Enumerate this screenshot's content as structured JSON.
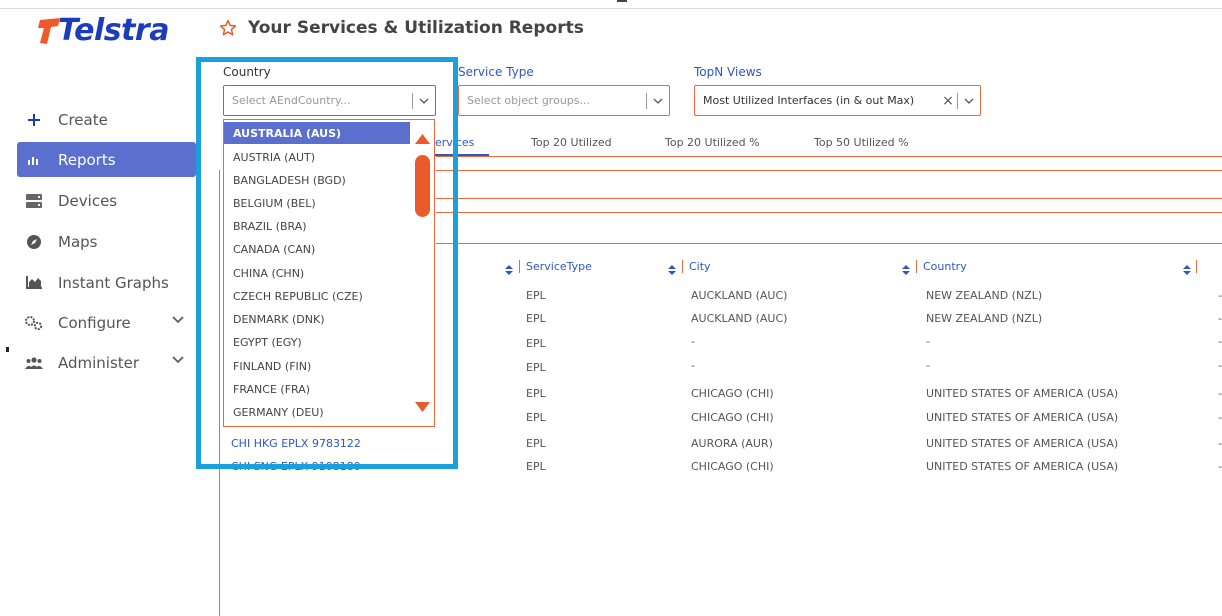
{
  "app": {
    "logo_text": "Telstra",
    "page_title": "Your Services & Utilization Reports",
    "accent_color": "#ea6a3e",
    "brand_color": "#1a3cbd",
    "active_color": "#5b6fcf"
  },
  "sidebar": {
    "items": [
      {
        "label": "Create",
        "icon": "plus-icon",
        "active": false
      },
      {
        "label": "Reports",
        "icon": "bar-chart-icon",
        "active": true
      },
      {
        "label": "Devices",
        "icon": "server-icon",
        "active": false
      },
      {
        "label": "Maps",
        "icon": "compass-icon",
        "active": false
      },
      {
        "label": "Instant Graphs",
        "icon": "area-chart-icon",
        "active": false
      },
      {
        "label": "Configure",
        "icon": "gears-icon",
        "active": false
      },
      {
        "label": "Administer",
        "icon": "users-icon",
        "active": false
      }
    ]
  },
  "filters": {
    "country": {
      "label": "Country",
      "placeholder": "Select AEndCountry..."
    },
    "service_type": {
      "label": "Service Type",
      "placeholder": "Select object groups..."
    },
    "topn": {
      "label": "TopN Views",
      "value": "Most Utilized Interfaces (in & out Max)"
    }
  },
  "country_dropdown": {
    "options": [
      "AUSTRALIA (AUS)",
      "AUSTRIA (AUT)",
      "BANGLADESH (BGD)",
      "BELGIUM (BEL)",
      "BRAZIL (BRA)",
      "CANADA (CAN)",
      "CHINA (CHN)",
      "CZECH REPUBLIC (CZE)",
      "DENMARK (DNK)",
      "EGYPT (EGY)",
      "FINLAND (FIN)",
      "FRANCE (FRA)",
      "GERMANY (DEU)"
    ],
    "selected": "AUSTRALIA (AUS)"
  },
  "tabs": {
    "items": [
      "ervices",
      "Top 20 Utilized",
      "Top 20 Utilized %",
      "Top 50 Utilized %"
    ]
  },
  "table": {
    "headers": [
      "ServiceType",
      "City",
      "Country"
    ],
    "rows": [
      {
        "name": "",
        "service_type": "EPL",
        "city": "AUCKLAND (AUC)",
        "country": "NEW ZEALAND (NZL)",
        "extra": "-"
      },
      {
        "name": "",
        "service_type": "EPL",
        "city": "AUCKLAND (AUC)",
        "country": "NEW ZEALAND (NZL)",
        "extra": "-"
      },
      {
        "name": "",
        "service_type": "EPL",
        "city": "-",
        "country": "-",
        "extra": "-"
      },
      {
        "name": "",
        "service_type": "EPL",
        "city": "-",
        "country": "-",
        "extra": "-"
      },
      {
        "name": "",
        "service_type": "EPL",
        "city": "CHICAGO (CHI)",
        "country": "UNITED STATES OF AMERICA (USA)",
        "extra": "-"
      },
      {
        "name": "",
        "service_type": "EPL",
        "city": "CHICAGO (CHI)",
        "country": "UNITED STATES OF AMERICA (USA)",
        "extra": "-"
      },
      {
        "name": "CHI HKG EPLX 9783122",
        "service_type": "EPL",
        "city": "AURORA (AUR)",
        "country": "UNITED STATES OF AMERICA (USA)",
        "extra": "-"
      },
      {
        "name": "CHI SNG EPLX 9108180",
        "service_type": "EPL",
        "city": "CHICAGO (CHI)",
        "country": "UNITED STATES OF AMERICA (USA)",
        "extra": "-"
      }
    ]
  }
}
